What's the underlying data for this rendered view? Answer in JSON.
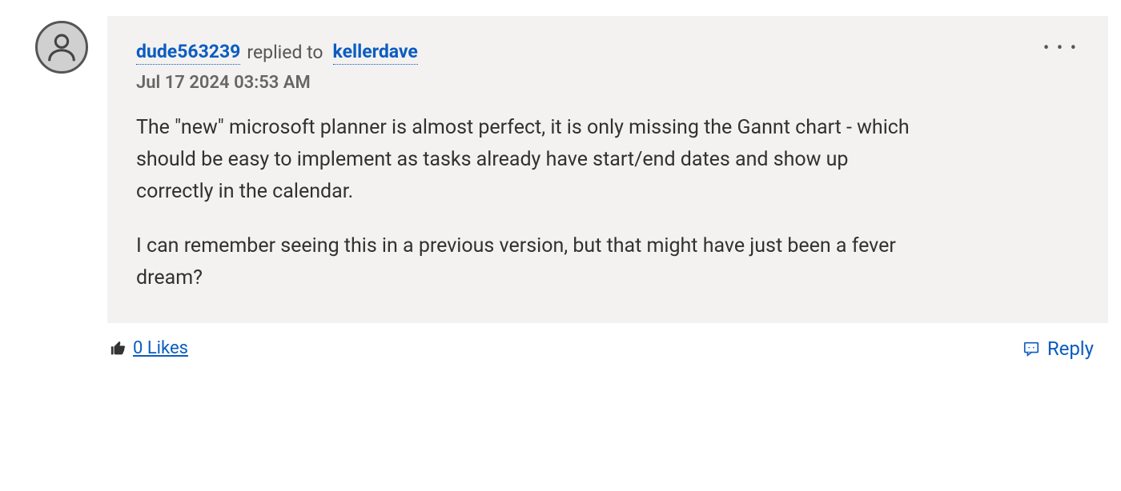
{
  "comment": {
    "author": "dude563239",
    "replied_label": "replied to",
    "reply_target": "kellerdave",
    "timestamp": "Jul 17 2024  03:53 AM",
    "paragraphs": [
      "The \"new\" microsoft planner is almost perfect, it is only missing the Gannt chart - which should be easy to implement as tasks already have start/end dates and show up correctly in the calendar.",
      "I can remember seeing this in a previous version, but that might have just been a fever dream?"
    ]
  },
  "footer": {
    "likes_count": 0,
    "likes_label": "0 Likes",
    "reply_label": "Reply"
  }
}
